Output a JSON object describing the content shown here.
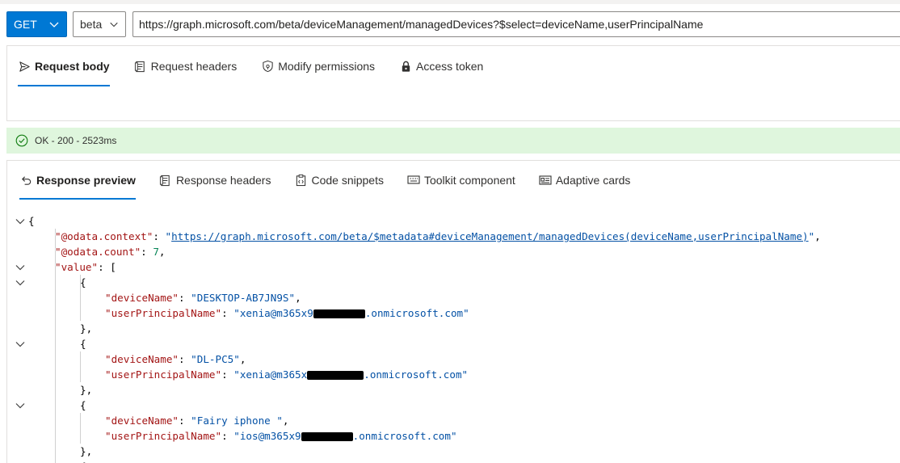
{
  "request": {
    "method": "GET",
    "version": "beta",
    "url": "https://graph.microsoft.com/beta/deviceManagement/managedDevices?$select=deviceName,userPrincipalName"
  },
  "request_tabs": [
    {
      "label": "Request body",
      "icon": "send-icon"
    },
    {
      "label": "Request headers",
      "icon": "document-icon"
    },
    {
      "label": "Modify permissions",
      "icon": "shield-lock-icon"
    },
    {
      "label": "Access token",
      "icon": "lock-icon"
    }
  ],
  "status": {
    "text": "OK - 200 - 2523ms",
    "icon": "check-circle-icon",
    "color": "#dff6dd"
  },
  "response_tabs": [
    {
      "label": "Response preview",
      "icon": "undo-arrow-icon"
    },
    {
      "label": "Response headers",
      "icon": "document-icon"
    },
    {
      "label": "Code snippets",
      "icon": "clipboard-code-icon"
    },
    {
      "label": "Toolkit component",
      "icon": "keyboard-icon"
    },
    {
      "label": "Adaptive cards",
      "icon": "card-icon"
    }
  ],
  "json": {
    "open_brace": "{",
    "context_key": "\"@odata.context\"",
    "context_value": "https://graph.microsoft.com/beta/$metadata#deviceManagement/managedDevices(deviceName,userPrincipalName)",
    "count_key": "\"@odata.count\"",
    "count_value": "7",
    "value_key": "\"value\"",
    "devices": [
      {
        "deviceName": "\"DESKTOP-AB7JN9S\"",
        "upn_prefix": "\"xenia@m365x9",
        "upn_suffix": ".onmicrosoft.com\""
      },
      {
        "deviceName": "\"DL-PC5\"",
        "upn_prefix": "\"xenia@m365x",
        "upn_suffix": ".onmicrosoft.com\""
      },
      {
        "deviceName": "\"Fairy iphone \"",
        "upn_prefix": "\"ios@m365x9",
        "upn_suffix": ".onmicrosoft.com\""
      }
    ],
    "deviceName_key": "\"deviceName\"",
    "upn_key": "\"userPrincipalName\""
  },
  "colors": {
    "accent": "#0078d4",
    "success_bg": "#dff6dd"
  }
}
